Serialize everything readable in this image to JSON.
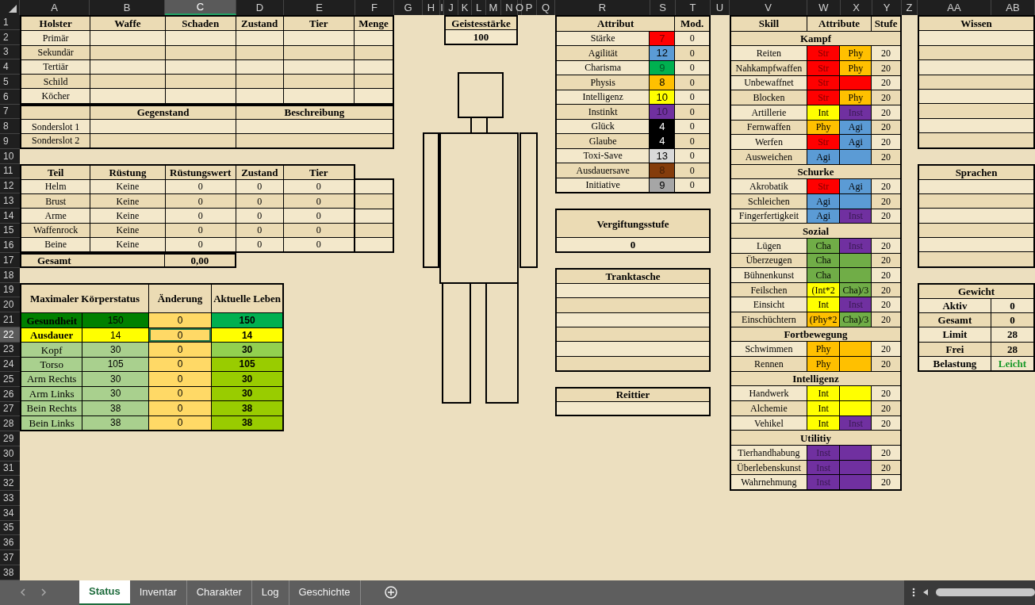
{
  "column_headers": [
    {
      "label": "A",
      "selected": false
    },
    {
      "label": "B",
      "selected": false
    },
    {
      "label": "C",
      "selected": true
    },
    {
      "label": "D",
      "selected": false
    },
    {
      "label": "E",
      "selected": false
    },
    {
      "label": "F",
      "selected": false
    },
    {
      "label": "G",
      "selected": false
    },
    {
      "label": "H",
      "selected": false
    },
    {
      "label": "I",
      "selected": false
    },
    {
      "label": "J",
      "selected": false
    },
    {
      "label": "K",
      "selected": false
    },
    {
      "label": "L",
      "selected": false
    },
    {
      "label": "M",
      "selected": false
    },
    {
      "label": "N",
      "selected": false
    },
    {
      "label": "O",
      "selected": false
    },
    {
      "label": "P",
      "selected": false
    },
    {
      "label": "Q",
      "selected": false
    },
    {
      "label": "R",
      "selected": false
    },
    {
      "label": "S",
      "selected": false
    },
    {
      "label": "T",
      "selected": false
    },
    {
      "label": "U",
      "selected": false
    },
    {
      "label": "V",
      "selected": false
    },
    {
      "label": "W",
      "selected": false
    },
    {
      "label": "X",
      "selected": false
    },
    {
      "label": "Y",
      "selected": false
    },
    {
      "label": "Z",
      "selected": false
    },
    {
      "label": "AA",
      "selected": false
    },
    {
      "label": "AB",
      "selected": false
    }
  ],
  "row_headers": [
    {
      "label": "1",
      "selected": false
    },
    {
      "label": "2",
      "selected": false
    },
    {
      "label": "3",
      "selected": false
    },
    {
      "label": "4",
      "selected": false
    },
    {
      "label": "5",
      "selected": false
    },
    {
      "label": "6",
      "selected": false
    },
    {
      "label": "7",
      "selected": false
    },
    {
      "label": "8",
      "selected": false
    },
    {
      "label": "9",
      "selected": false
    },
    {
      "label": "10",
      "selected": false
    },
    {
      "label": "11",
      "selected": false
    },
    {
      "label": "12",
      "selected": false
    },
    {
      "label": "13",
      "selected": false
    },
    {
      "label": "14",
      "selected": false
    },
    {
      "label": "15",
      "selected": false
    },
    {
      "label": "16",
      "selected": false
    },
    {
      "label": "17",
      "selected": false
    },
    {
      "label": "18",
      "selected": false
    },
    {
      "label": "19",
      "selected": false
    },
    {
      "label": "20",
      "selected": false
    },
    {
      "label": "21",
      "selected": false
    },
    {
      "label": "22",
      "selected": true
    },
    {
      "label": "23",
      "selected": false
    },
    {
      "label": "24",
      "selected": false
    },
    {
      "label": "25",
      "selected": false
    },
    {
      "label": "26",
      "selected": false
    },
    {
      "label": "27",
      "selected": false
    },
    {
      "label": "28",
      "selected": false
    },
    {
      "label": "29",
      "selected": false
    },
    {
      "label": "30",
      "selected": false
    },
    {
      "label": "31",
      "selected": false
    },
    {
      "label": "32",
      "selected": false
    },
    {
      "label": "33",
      "selected": false
    },
    {
      "label": "34",
      "selected": false
    },
    {
      "label": "35",
      "selected": false
    },
    {
      "label": "36",
      "selected": false
    },
    {
      "label": "37",
      "selected": false
    },
    {
      "label": "38",
      "selected": false
    }
  ],
  "holster": {
    "columns": [
      "Holster",
      "Waffe",
      "Schaden",
      "Zustand",
      "Tier",
      "Menge"
    ],
    "rows": [
      {
        "slot": "Primär"
      },
      {
        "slot": "Sekundär"
      },
      {
        "slot": "Tertiär"
      },
      {
        "slot": "Schild"
      },
      {
        "slot": "Köcher"
      }
    ]
  },
  "special_slots": {
    "columns": [
      "Gegenstand",
      "Beschreibung"
    ],
    "rows": [
      {
        "slot": "Sonderslot 1"
      },
      {
        "slot": "Sonderslot 2"
      }
    ]
  },
  "armor": {
    "columns": [
      "Teil",
      "Rüstung",
      "Rüstungswert",
      "Zustand",
      "Tier"
    ],
    "rows": [
      {
        "part": "Helm",
        "armor": "Keine",
        "armor_value": "0",
        "condition": "0",
        "tier": "0"
      },
      {
        "part": "Brust",
        "armor": "Keine",
        "armor_value": "0",
        "condition": "0",
        "tier": "0"
      },
      {
        "part": "Arme",
        "armor": "Keine",
        "armor_value": "0",
        "condition": "0",
        "tier": "0"
      },
      {
        "part": "Waffenrock",
        "armor": "Keine",
        "armor_value": "0",
        "condition": "0",
        "tier": "0"
      },
      {
        "part": "Beine",
        "armor": "Keine",
        "armor_value": "0",
        "condition": "0",
        "tier": "0"
      }
    ],
    "total_label": "Gesamt",
    "total_value": "0,00"
  },
  "body_status": {
    "columns": [
      "Maximaler Körperstatus",
      "Änderung",
      "Aktuelle Leben"
    ],
    "rows": [
      {
        "label": "Gesundheit",
        "kind": "main",
        "max": "150",
        "change": "0",
        "current": {
          "text": "150",
          "color": "#00b050"
        },
        "color": "#008000",
        "selected": false
      },
      {
        "label": "Ausdauer",
        "kind": "main",
        "max": "14",
        "change": "0",
        "current": {
          "text": "14",
          "color": "#ffff00"
        },
        "color": "#ffff00",
        "selected": true
      },
      {
        "label": "Kopf",
        "kind": "part",
        "max": "30",
        "change": "0",
        "current": {
          "text": "30",
          "color": "#92d050"
        },
        "color": "#a9d08e",
        "selected": false
      },
      {
        "label": "Torso",
        "kind": "part",
        "max": "105",
        "change": "0",
        "current": {
          "text": "105",
          "color": "#99cc00"
        },
        "color": "#a9d08e",
        "selected": false
      },
      {
        "label": "Arm Rechts",
        "kind": "part",
        "max": "30",
        "change": "0",
        "current": {
          "text": "30",
          "color": "#99cc00"
        },
        "color": "#a9d08e",
        "selected": false
      },
      {
        "label": "Arm Links",
        "kind": "part",
        "max": "30",
        "change": "0",
        "current": {
          "text": "30",
          "color": "#99cc00"
        },
        "color": "#a9d08e",
        "selected": false
      },
      {
        "label": "Bein Rechts",
        "kind": "part",
        "max": "38",
        "change": "0",
        "current": {
          "text": "38",
          "color": "#99cc00"
        },
        "color": "#a9d08e",
        "selected": false
      },
      {
        "label": "Bein Links",
        "kind": "part",
        "max": "38",
        "change": "0",
        "current": {
          "text": "38",
          "color": "#99cc00"
        },
        "color": "#a9d08e",
        "selected": false
      }
    ]
  },
  "mental_strength": {
    "label": "Geistesstärke",
    "value": "100"
  },
  "attributes": {
    "columns": [
      "Attribut",
      "Mod."
    ],
    "rows": [
      {
        "name": "Stärke",
        "value": "7",
        "color": "#ff0000",
        "mod": "0"
      },
      {
        "name": "Agilität",
        "value": "12",
        "color": "#5b9bd5",
        "mod": "0"
      },
      {
        "name": "Charisma",
        "value": "9",
        "color": "#00b050",
        "mod": "0"
      },
      {
        "name": "Physis",
        "value": "8",
        "color": "#ffc000",
        "mod": "0"
      },
      {
        "name": "Intelligenz",
        "value": "10",
        "color": "#ffff00",
        "mod": "0"
      },
      {
        "name": "Instinkt",
        "value": "10",
        "color": "#7030a0",
        "mod": "0"
      },
      {
        "name": "Glück",
        "value": "4",
        "color": "#000000",
        "mod": "0"
      },
      {
        "name": "Glaube",
        "value": "4",
        "color": "#000000",
        "mod": "0"
      },
      {
        "name": "Toxi-Save",
        "value": "13",
        "color": "#d9d9d9",
        "mod": "0"
      },
      {
        "name": "Ausdauersave",
        "value": "8",
        "color": "#843c0c",
        "mod": "0"
      },
      {
        "name": "Initiative",
        "value": "9",
        "color": "#a6a6a6",
        "mod": "0"
      }
    ]
  },
  "poison_level": {
    "label": "Vergiftungsstufe",
    "value": "0"
  },
  "potion_bag": {
    "label": "Tranktasche"
  },
  "mount": {
    "label": "Reittier"
  },
  "skills": {
    "columns": [
      "Skill",
      "Attribute",
      "Stufe"
    ],
    "groups": [
      {
        "name": "Kampf",
        "skills": [
          {
            "name": "Reiten",
            "attributes": [
              {
                "text": "Str",
                "color": "#ff0000"
              },
              {
                "text": "Phy",
                "color": "#ffc000"
              }
            ],
            "rank": "20"
          },
          {
            "name": "Nahkampfwaffen",
            "attributes": [
              {
                "text": "Str",
                "color": "#ff0000"
              },
              {
                "text": "Phy",
                "color": "#ffc000"
              }
            ],
            "rank": "20"
          },
          {
            "name": "Unbewaffnet",
            "attributes": [
              {
                "text": "Str",
                "color": "#ff0000"
              },
              {
                "color": "#ff0000"
              }
            ],
            "rank": "20"
          },
          {
            "name": "Blocken",
            "attributes": [
              {
                "text": "Str",
                "color": "#ff0000"
              },
              {
                "text": "Phy",
                "color": "#ffc000"
              }
            ],
            "rank": "20"
          },
          {
            "name": "Artillerie",
            "attributes": [
              {
                "text": "Int",
                "color": "#ffff00"
              },
              {
                "text": "Inst",
                "color": "#7030a0"
              }
            ],
            "rank": "20"
          },
          {
            "name": "Fernwaffen",
            "attributes": [
              {
                "text": "Phy",
                "color": "#ffc000"
              },
              {
                "text": "Agi",
                "color": "#5b9bd5"
              }
            ],
            "rank": "20"
          },
          {
            "name": "Werfen",
            "attributes": [
              {
                "text": "Str",
                "color": "#ff0000"
              },
              {
                "text": "Agi",
                "color": "#5b9bd5"
              }
            ],
            "rank": "20"
          },
          {
            "name": "Ausweichen",
            "attributes": [
              {
                "text": "Agi",
                "color": "#5b9bd5"
              },
              {
                "color": "#5b9bd5"
              }
            ],
            "rank": "20"
          }
        ]
      },
      {
        "name": "Schurke",
        "skills": [
          {
            "name": "Akrobatik",
            "attributes": [
              {
                "text": "Str",
                "color": "#ff0000"
              },
              {
                "text": "Agi",
                "color": "#5b9bd5"
              }
            ],
            "rank": "20"
          },
          {
            "name": "Schleichen",
            "attributes": [
              {
                "text": "Agi",
                "color": "#5b9bd5"
              },
              {
                "color": "#5b9bd5"
              }
            ],
            "rank": "20"
          },
          {
            "name": "Fingerfertigkeit",
            "attributes": [
              {
                "text": "Agi",
                "color": "#5b9bd5"
              },
              {
                "text": "Inst",
                "color": "#7030a0"
              }
            ],
            "rank": "20"
          }
        ]
      },
      {
        "name": "Sozial",
        "skills": [
          {
            "name": "Lügen",
            "attributes": [
              {
                "text": "Cha",
                "color": "#70ad47"
              },
              {
                "text": "Inst",
                "color": "#7030a0"
              }
            ],
            "rank": "20"
          },
          {
            "name": "Überzeugen",
            "attributes": [
              {
                "text": "Cha",
                "color": "#70ad47"
              },
              {
                "color": "#70ad47"
              }
            ],
            "rank": "20"
          },
          {
            "name": "Bühnenkunst",
            "attributes": [
              {
                "text": "Cha",
                "color": "#70ad47"
              },
              {
                "color": "#70ad47"
              }
            ],
            "rank": "20"
          },
          {
            "name": "Feilschen",
            "attributes": [
              {
                "text": "(Int*2",
                "color": "#ffff00"
              },
              {
                "text": "Cha)/3",
                "color": "#70ad47"
              }
            ],
            "rank": "20"
          },
          {
            "name": "Einsicht",
            "attributes": [
              {
                "text": "Int",
                "color": "#ffff00"
              },
              {
                "text": "Inst",
                "color": "#7030a0"
              }
            ],
            "rank": "20"
          },
          {
            "name": "Einschüchtern",
            "attributes": [
              {
                "text": "(Phy*2",
                "color": "#ffc000"
              },
              {
                "text": "Cha)/3",
                "color": "#70ad47"
              }
            ],
            "rank": "20"
          }
        ]
      },
      {
        "name": "Fortbewegung",
        "skills": [
          {
            "name": "Schwimmen",
            "attributes": [
              {
                "text": "Phy",
                "color": "#ffc000"
              },
              {
                "color": "#ffc000"
              }
            ],
            "rank": "20"
          },
          {
            "name": "Rennen",
            "attributes": [
              {
                "text": "Phy",
                "color": "#ffc000"
              },
              {
                "color": "#ffc000"
              }
            ],
            "rank": "20"
          }
        ]
      },
      {
        "name": "Intelligenz",
        "skills": [
          {
            "name": "Handwerk",
            "attributes": [
              {
                "text": "Int",
                "color": "#ffff00"
              },
              {
                "color": "#ffff00"
              }
            ],
            "rank": "20"
          },
          {
            "name": "Alchemie",
            "attributes": [
              {
                "text": "Int",
                "color": "#ffff00"
              },
              {
                "color": "#ffff00"
              }
            ],
            "rank": "20"
          },
          {
            "name": "Vehikel",
            "attributes": [
              {
                "text": "Int",
                "color": "#ffff00"
              },
              {
                "text": "Inst",
                "color": "#7030a0"
              }
            ],
            "rank": "20"
          }
        ]
      },
      {
        "name": "Utilitiy",
        "skills": [
          {
            "name": "Tierhandhabung",
            "attributes": [
              {
                "text": "Inst",
                "color": "#7030a0"
              },
              {
                "color": "#7030a0"
              }
            ],
            "rank": "20"
          },
          {
            "name": "Überlebenskunst",
            "attributes": [
              {
                "text": "Inst",
                "color": "#7030a0"
              },
              {
                "color": "#7030a0"
              }
            ],
            "rank": "20"
          },
          {
            "name": "Wahrnehmung",
            "attributes": [
              {
                "text": "Inst",
                "color": "#7030a0"
              },
              {
                "color": "#7030a0"
              }
            ],
            "rank": "20"
          }
        ]
      }
    ]
  },
  "knowledge": {
    "label": "Wissen"
  },
  "languages": {
    "label": "Sprachen"
  },
  "weight": {
    "label": "Gewicht",
    "rows": [
      {
        "label": "Aktiv",
        "value": "0"
      },
      {
        "label": "Gesamt",
        "value": "0"
      },
      {
        "label": "Limit",
        "value": "28"
      },
      {
        "label": "Frei",
        "value": "28"
      },
      {
        "label": "Belastung",
        "value": "Leicht",
        "color": "#1a9a2a"
      }
    ]
  },
  "sheet_tabs": [
    {
      "label": "Status",
      "selected": true
    },
    {
      "label": "Inventar",
      "selected": false
    },
    {
      "label": "Charakter",
      "selected": false
    },
    {
      "label": "Log",
      "selected": false
    },
    {
      "label": "Geschichte",
      "selected": false
    }
  ]
}
